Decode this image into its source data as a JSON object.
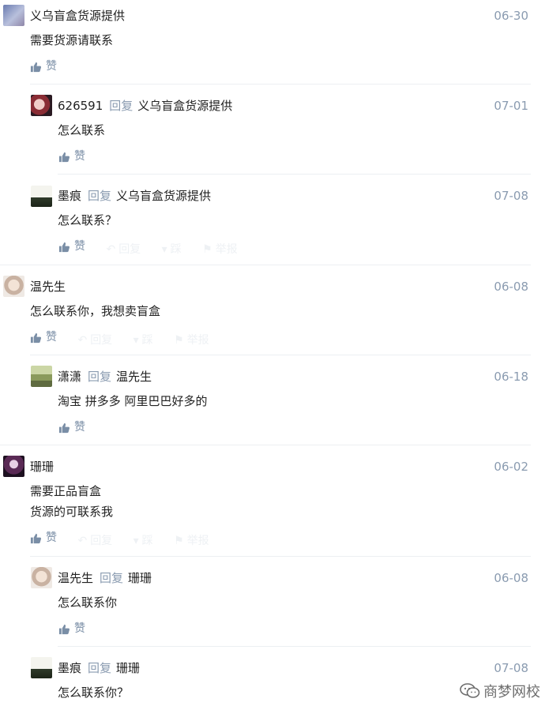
{
  "comments": [
    {
      "name": "义乌盲盒货源提供",
      "date": "06-30",
      "lines": [
        "需要货源请联系"
      ],
      "like": "赞"
    },
    {
      "name": "626591",
      "reply": "回复",
      "to": "义乌盲盒货源提供",
      "date": "07-01",
      "lines": [
        "怎么联系"
      ],
      "like": "赞"
    },
    {
      "name": "墨痕",
      "reply": "回复",
      "to": "义乌盲盒货源提供",
      "date": "07-08",
      "lines": [
        "怎么联系？"
      ],
      "like": "赞",
      "ghost": [
        "回复",
        "踩",
        "举报"
      ]
    },
    {
      "name": "温先生",
      "date": "06-08",
      "lines": [
        "怎么联系你，我想卖盲盒"
      ],
      "like": "赞",
      "ghost": [
        "回复",
        "踩",
        "举报"
      ]
    },
    {
      "name": "潇潇",
      "reply": "回复",
      "to": "温先生",
      "date": "06-18",
      "lines": [
        "淘宝 拼多多 阿里巴巴好多的"
      ],
      "like": "赞"
    },
    {
      "name": "珊珊",
      "date": "06-02",
      "lines": [
        "需要正品盲盒",
        "货源的可联系我"
      ],
      "like": "赞",
      "ghost": [
        "回复",
        "踩",
        "举报"
      ]
    },
    {
      "name": "温先生",
      "reply": "回复",
      "to": "珊珊",
      "date": "06-08",
      "lines": [
        "怎么联系你"
      ],
      "like": "赞"
    },
    {
      "name": "墨痕",
      "reply": "回复",
      "to": "珊珊",
      "date": "07-08",
      "lines": [
        "怎么联系你？"
      ]
    }
  ],
  "watermark": "商梦网校",
  "colors": {
    "name": "#222222",
    "meta": "#8a9bb0",
    "like": "#7a8ea6",
    "divider": "#eceff2"
  }
}
